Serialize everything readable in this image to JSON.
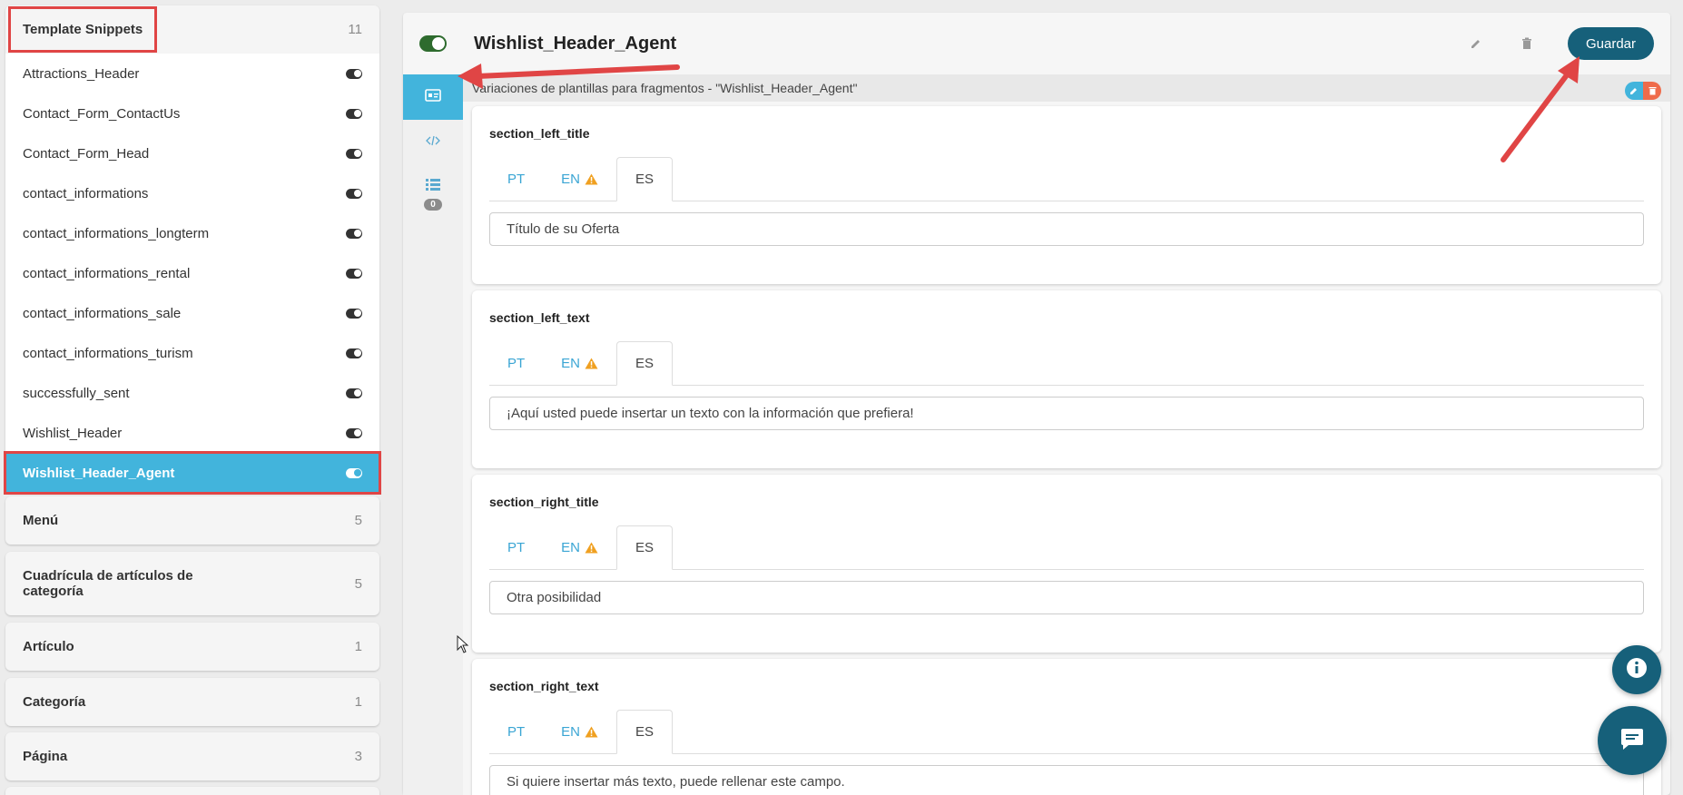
{
  "sidebar": {
    "template_snippets": {
      "title": "Template Snippets",
      "count": "11",
      "items": [
        {
          "label": "Attractions_Header"
        },
        {
          "label": "Contact_Form_ContactUs"
        },
        {
          "label": "Contact_Form_Head"
        },
        {
          "label": "contact_informations"
        },
        {
          "label": "contact_informations_longterm"
        },
        {
          "label": "contact_informations_rental"
        },
        {
          "label": "contact_informations_sale"
        },
        {
          "label": "contact_informations_turism"
        },
        {
          "label": "successfully_sent"
        },
        {
          "label": "Wishlist_Header"
        },
        {
          "label": "Wishlist_Header_Agent",
          "active": true
        }
      ]
    },
    "groups": [
      {
        "title": "Menú",
        "count": "5"
      },
      {
        "title": "Cuadrícula de artículos de categoría",
        "count": "5"
      },
      {
        "title": "Artículo",
        "count": "1"
      },
      {
        "title": "Categoría",
        "count": "1"
      },
      {
        "title": "Página",
        "count": "3"
      }
    ]
  },
  "main": {
    "title": "Wishlist_Header_Agent",
    "save_label": "Guardar",
    "rail_badge": "0",
    "variations_label": "Variaciones de plantillas para fragmentos - \"Wishlist_Header_Agent\"",
    "tabs": [
      "PT",
      "EN",
      "ES"
    ],
    "active_tab": "ES",
    "fields": [
      {
        "name": "section_left_title",
        "value": "Título de su Oferta"
      },
      {
        "name": "section_left_text",
        "value": "¡Aquí usted puede insertar un texto con la información que prefiera!"
      },
      {
        "name": "section_right_title",
        "value": "Otra posibilidad"
      },
      {
        "name": "section_right_text",
        "value": "Si quiere insertar más texto, puede rellenar este campo."
      }
    ]
  },
  "colors": {
    "accent": "#42b4dc",
    "primary": "#16607a",
    "highlight": "#e04545",
    "warning": "#f0a020",
    "toggle_on": "#2e6b2e"
  },
  "icons": {
    "edit": "pencil-icon",
    "delete": "trash-icon",
    "info": "info-icon",
    "chat": "chat-icon",
    "warning": "warning-icon"
  }
}
